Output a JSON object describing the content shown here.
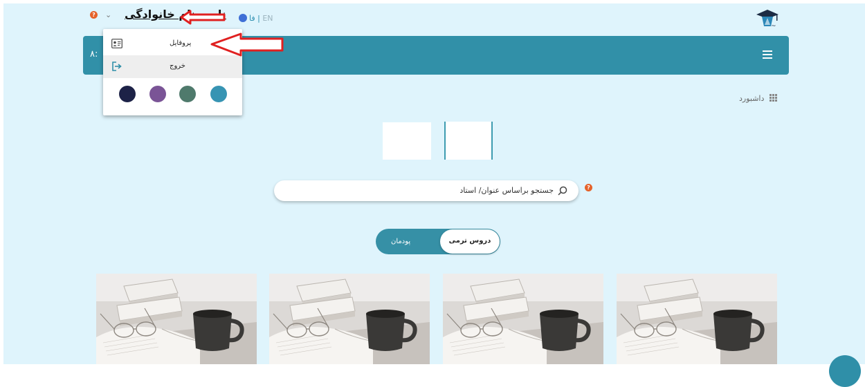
{
  "header": {
    "user_name": "نام و نام خانوادگی",
    "lang_en": "EN",
    "lang_separator": "|",
    "lang_fa": "فا",
    "help_mark": "?"
  },
  "teal_bar": {
    "time_fragment": "٨:"
  },
  "dropdown": {
    "items": [
      {
        "label": "پروفایل",
        "icon": "profile-card-icon"
      },
      {
        "label": "خروج",
        "icon": "logout-icon"
      }
    ],
    "theme_colors": [
      "#1d2247",
      "#7a5496",
      "#4f7a6c",
      "#3794b3"
    ]
  },
  "breadcrumb": {
    "label": "داشبورد",
    "icon": "grid-icon"
  },
  "search": {
    "placeholder": "جستجو براساس عنوان/ استاد",
    "help_mark": "?"
  },
  "toggle": {
    "active_label": "دروس ترمی",
    "inactive_label": "پودمان"
  },
  "cards": [
    {
      "image": "course-image"
    },
    {
      "image": "course-image"
    },
    {
      "image": "course-image"
    },
    {
      "image": "course-image"
    }
  ],
  "colors": {
    "background": "#dff4fc",
    "accent": "#3190a8",
    "help_badge": "#e5622a",
    "annotation": "#e02020"
  }
}
